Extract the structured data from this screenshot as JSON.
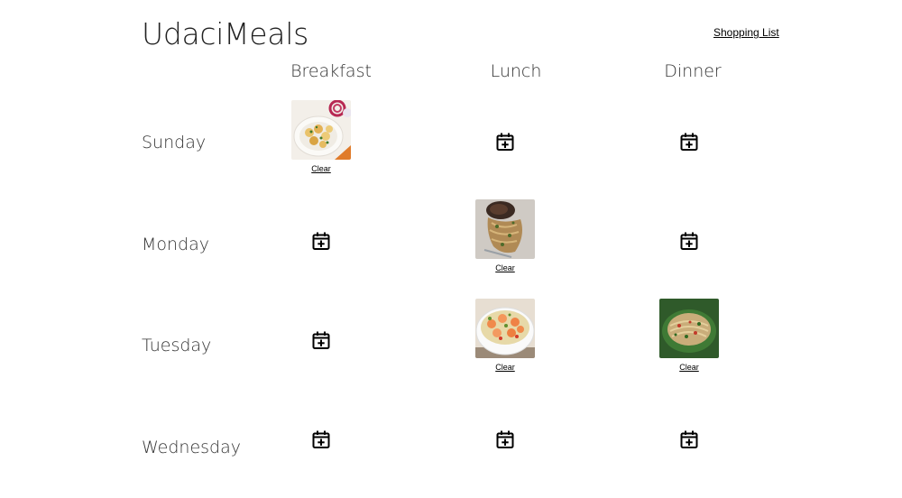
{
  "app": {
    "title": "UdaciMeals",
    "shopping_link": "Shopping List"
  },
  "meals": [
    "Breakfast",
    "Lunch",
    "Dinner"
  ],
  "days": [
    {
      "name": "Sunday",
      "slots": {
        "breakfast": "image",
        "lunch": "empty",
        "dinner": "empty"
      }
    },
    {
      "name": "Monday",
      "slots": {
        "breakfast": "empty",
        "lunch": "image",
        "dinner": "empty"
      }
    },
    {
      "name": "Tuesday",
      "slots": {
        "breakfast": "empty",
        "lunch": "image",
        "dinner": "image"
      }
    },
    {
      "name": "Wednesday",
      "slots": {
        "breakfast": "empty",
        "lunch": "empty",
        "dinner": "empty"
      }
    }
  ],
  "clear_label": "Clear",
  "icons": {
    "add": "calendar-plus-icon"
  }
}
